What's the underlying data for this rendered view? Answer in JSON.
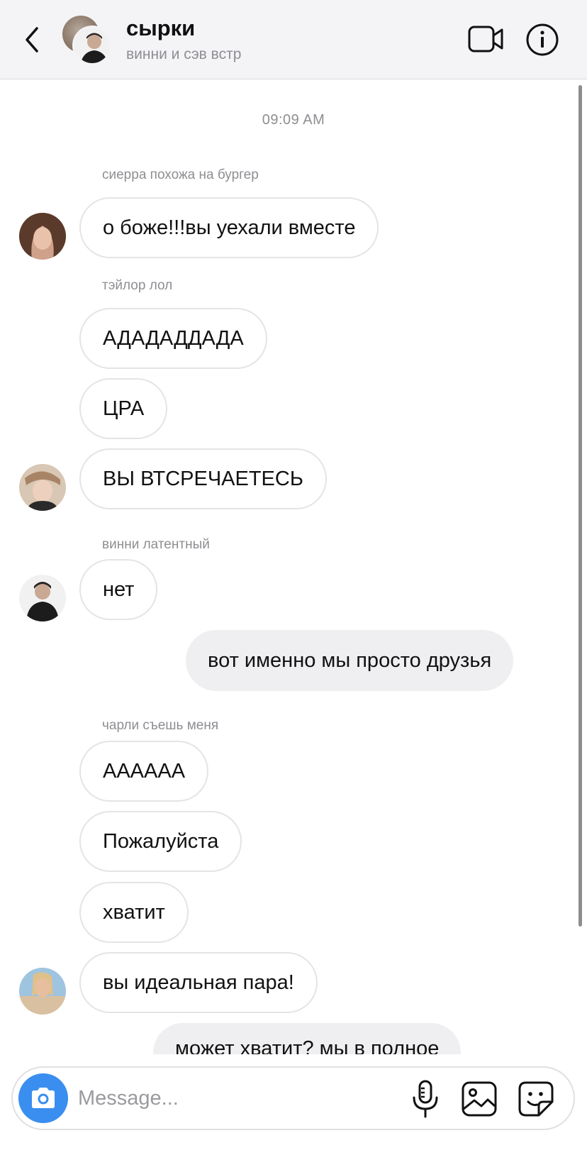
{
  "header": {
    "title": "сырки",
    "subtitle": "винни и сэв встр",
    "icons": {
      "back": "chevron-left-icon",
      "video": "video-camera-icon",
      "info": "info-icon"
    }
  },
  "chat": {
    "timestamp": "09:09 AM",
    "senders": {
      "s1": "сиерра похожа на бургер",
      "s2": "тэйлор лол",
      "s3": "винни латентный",
      "s4": "чарли съешь меня"
    },
    "messages": [
      "о боже!!!вы уехали вместе",
      "АДАДАДДАДА",
      "ЦРА",
      "ВЫ ВТСРЕЧАЕТЕСЬ",
      "нет",
      "вот именно мы просто друзья",
      "АААААА",
      "Пожалуйста",
      "хватит",
      "вы идеальная пара!",
      "может хватит? мы в полное"
    ]
  },
  "composer": {
    "placeholder": "Message...",
    "value": "",
    "icons": {
      "camera": "camera-icon",
      "mic": "microphone-icon",
      "gallery": "gallery-icon",
      "sticker": "sticker-icon"
    },
    "accent": "#3a8ef0"
  }
}
